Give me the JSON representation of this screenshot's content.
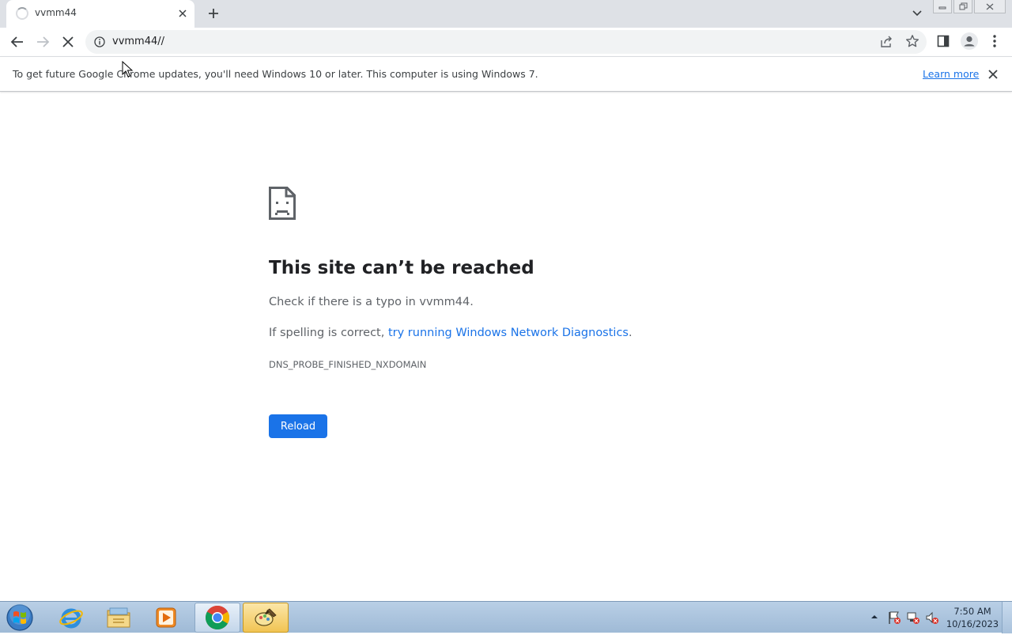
{
  "browser": {
    "tab": {
      "title": "vvmm44",
      "close_label": "✕"
    },
    "new_tab_label": "+",
    "omnibox": {
      "url": "vvmm44//"
    }
  },
  "infobar": {
    "message": "To get future Google Chrome updates, you'll need Windows 10 or later. This computer is using Windows 7.",
    "link_label": "Learn more"
  },
  "error_page": {
    "title": "This site can’t be reached",
    "typo_hint": "Check if there is a typo in vvmm44.",
    "spelling_prefix": "If spelling is correct, ",
    "diagnostics_link": "try running Windows Network Diagnostics",
    "spelling_suffix": ".",
    "error_code": "DNS_PROBE_FINISHED_NXDOMAIN",
    "reload_label": "Reload"
  },
  "taskbar": {
    "apps": [
      "internet-explorer-icon",
      "file-explorer-icon",
      "media-player-icon",
      "chrome-icon",
      "paint-app-icon"
    ],
    "clock": {
      "time": "7:50 AM",
      "date": "10/16/2023"
    }
  },
  "colors": {
    "accent": "#1a73e8",
    "tabstrip": "#dee1e6",
    "omnibox": "#f1f3f4",
    "text_primary": "#202124",
    "text_secondary": "#5f6368"
  }
}
